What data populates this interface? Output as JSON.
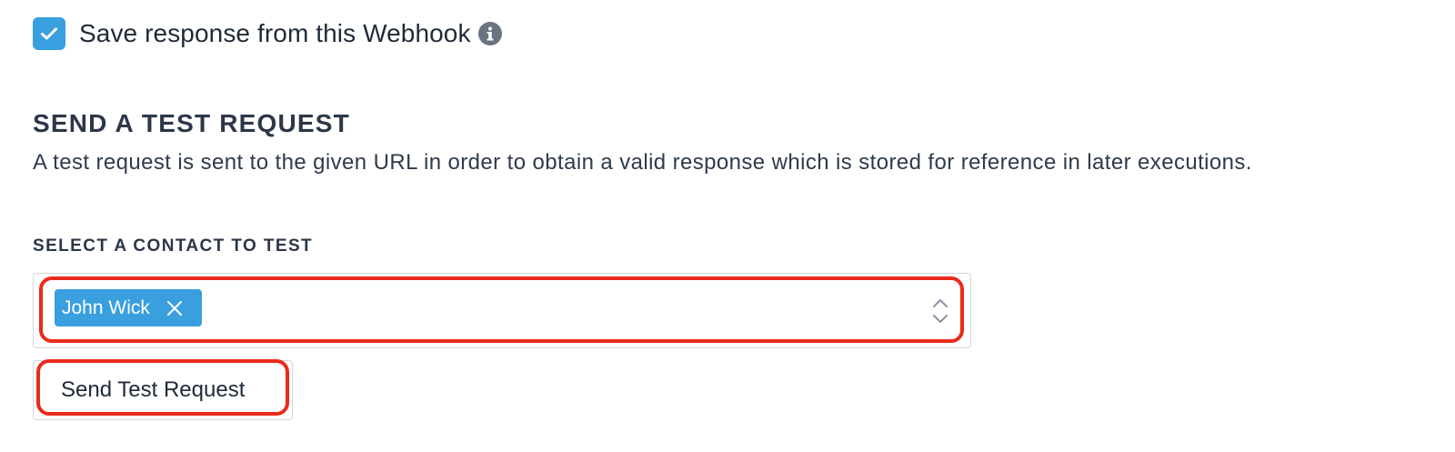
{
  "save_response": {
    "checked": true,
    "label": "Save response from this Webhook",
    "info_icon": "info-circle-icon"
  },
  "test_section": {
    "title": "SEND A TEST REQUEST",
    "description": "A test request is sent to the given URL in order to obtain a valid response which is stored for reference in later executions.",
    "select_label": "SELECT A CONTACT TO TEST",
    "selected_contacts": [
      {
        "label": "John Wick"
      }
    ],
    "send_button_label": "Send Test Request"
  },
  "colors": {
    "accent": "#3a9fdf",
    "highlight": "#ea2a1a",
    "text": "#1e2939"
  }
}
